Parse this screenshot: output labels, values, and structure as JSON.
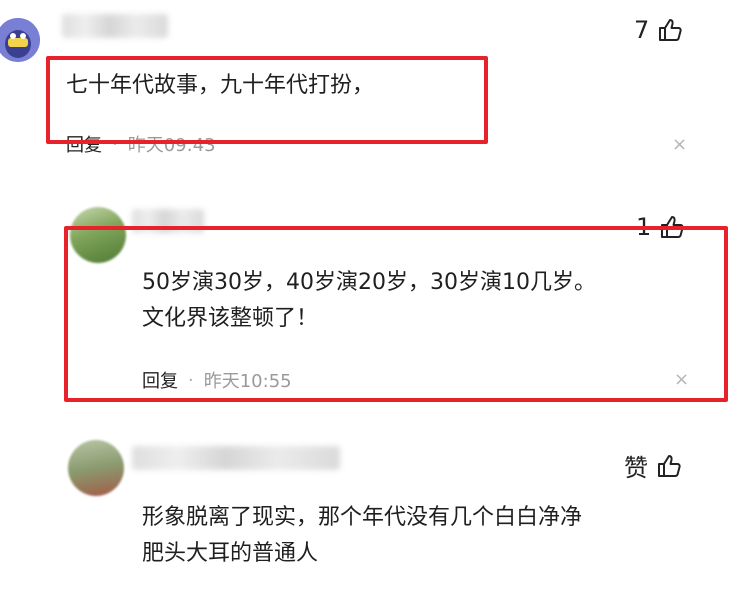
{
  "comments": [
    {
      "likes": "7",
      "text_lines": [
        "七十年代故事，九十年代打扮，"
      ],
      "reply_label": "回复",
      "separator": "·",
      "time": "昨天09:43",
      "close_glyph": "×"
    },
    {
      "likes": "1",
      "text_lines": [
        "50岁演30岁，40岁演20岁，30岁演10几岁。",
        "文化界该整顿了！"
      ],
      "reply_label": "回复",
      "separator": "·",
      "time": "昨天10:55",
      "close_glyph": "×"
    },
    {
      "likes": "赞",
      "text_lines": [
        "形象脱离了现实，那个年代没有几个白白净净",
        "肥头大耳的普通人"
      ]
    }
  ],
  "colors": {
    "highlight_box": "#e8222b",
    "meta_text": "#9a9a9a"
  },
  "icons": [
    "thumbs-up-icon",
    "close-icon"
  ]
}
